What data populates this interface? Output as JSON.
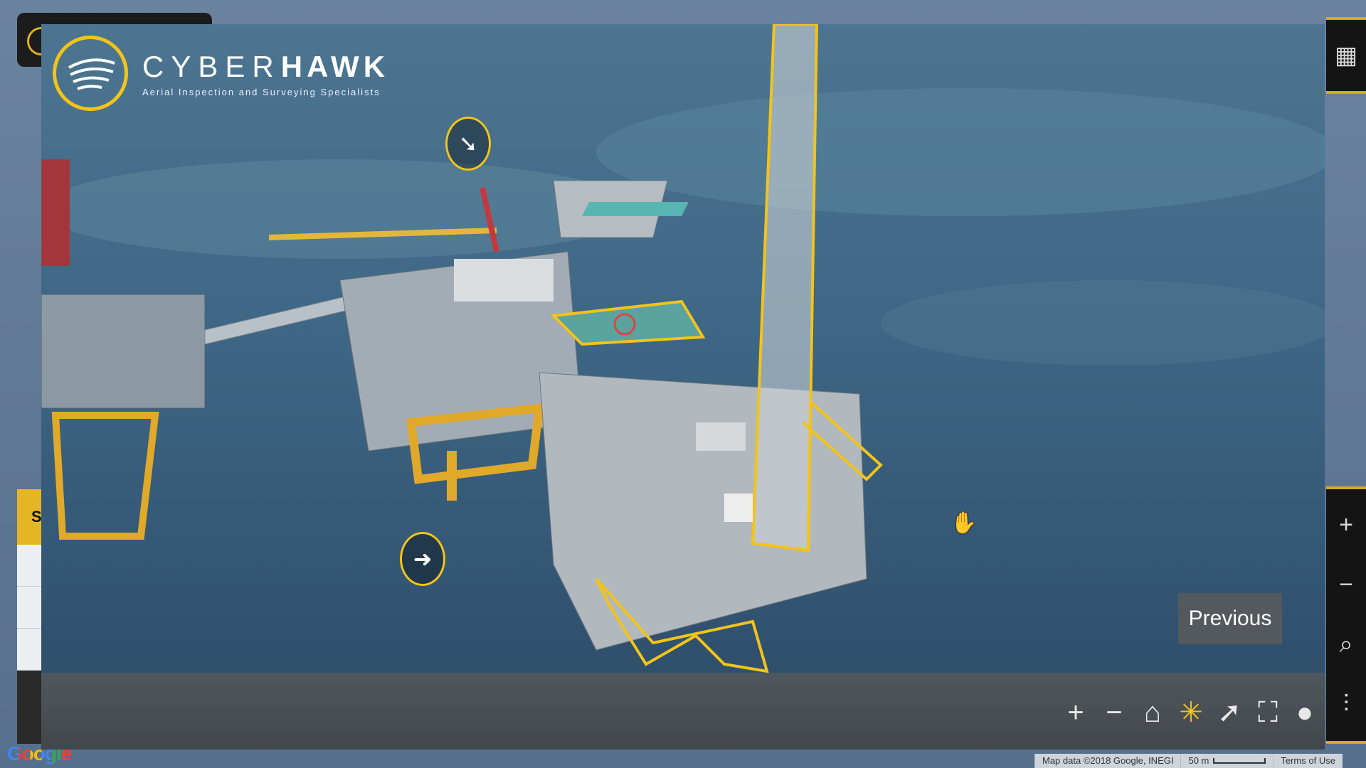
{
  "brand": {
    "name_light": "CYBER",
    "name_bold": "HAWK",
    "tagline": "Aerial Inspection and Surveying Specialists",
    "accent_color": "#f2c31a"
  },
  "viewer": {
    "previous_label": "Previous",
    "hotspots": [
      {
        "icon": "arrow-down-right-icon",
        "glyph": "➘"
      },
      {
        "icon": "arrow-right-icon",
        "glyph": "➜"
      }
    ],
    "toolbar": {
      "zoom_in": "+",
      "zoom_out": "−",
      "home": "⌂",
      "highlight": "✳",
      "arrow": "➚",
      "fullscreen": "⛶",
      "pin": "●"
    }
  },
  "background_app": {
    "panel_letter": "S",
    "rail": {
      "calendar": "▦",
      "zoom_in": "+",
      "zoom_out": "−",
      "zoom_select": "⌕",
      "settings": "⫶"
    }
  },
  "map_footer": {
    "google_logo": "Google",
    "map_data": "Map data ©2018 Google, INEGI",
    "scale_label": "50 m",
    "terms": "Terms of Use"
  }
}
